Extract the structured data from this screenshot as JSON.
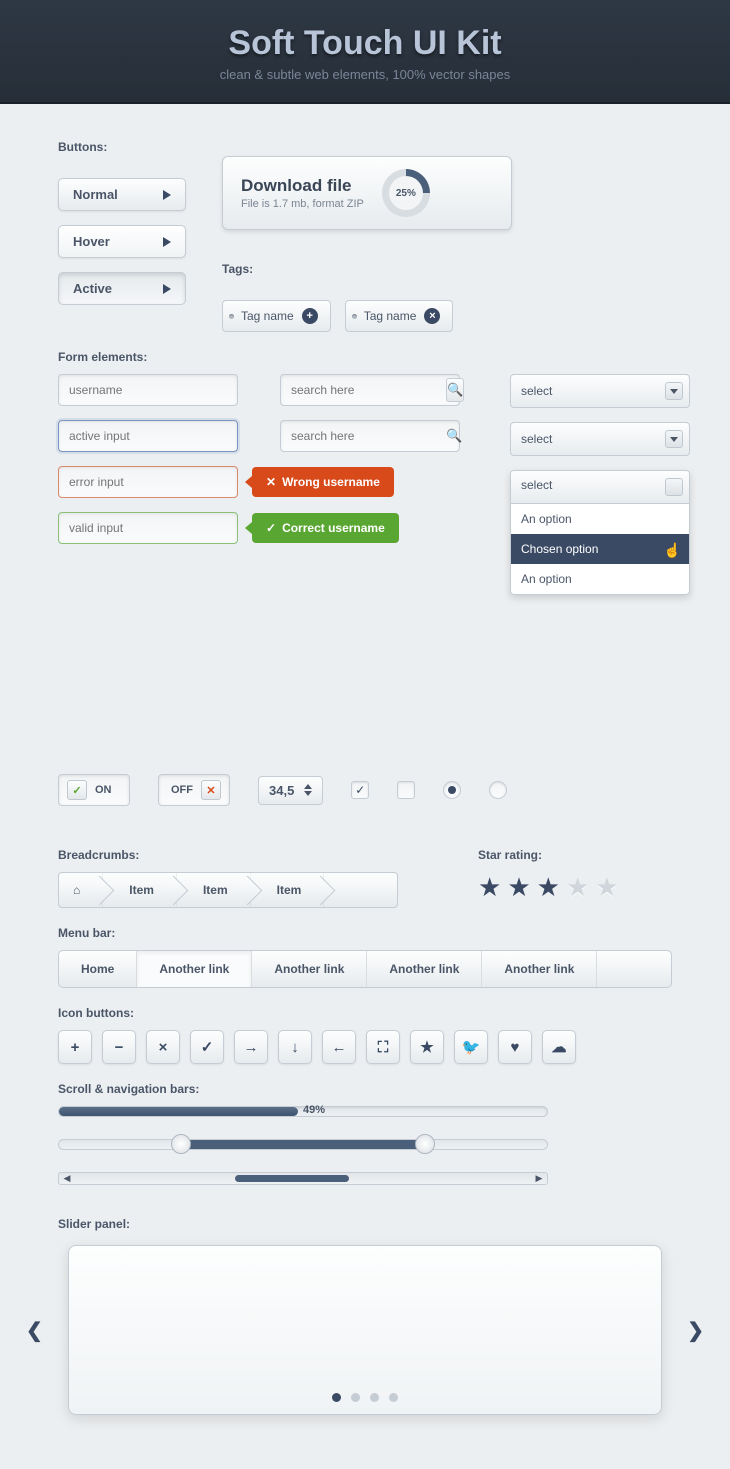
{
  "header": {
    "title": "Soft Touch UI Kit",
    "subtitle": "clean & subtle web elements, 100% vector shapes"
  },
  "sections": {
    "buttons": "Buttons:",
    "tags": "Tags:",
    "forms": "Form elements:",
    "crumbs": "Breadcrumbs:",
    "stars": "Star rating:",
    "menu": "Menu bar:",
    "icons": "Icon buttons:",
    "scroll": "Scroll & navigation bars:",
    "slider": "Slider panel:"
  },
  "buttons": {
    "normal": "Normal",
    "hover": "Hover",
    "active": "Active"
  },
  "download": {
    "title": "Download file",
    "sub": "File is 1.7 mb, format ZIP",
    "pct": "25%"
  },
  "tags": [
    "Tag name",
    "Tag name"
  ],
  "inputs": {
    "ph0": "username",
    "ph1": "active input",
    "ph2": "error input",
    "ph3": "valid input",
    "search": "search here"
  },
  "tips": {
    "err": "Wrong username",
    "ok": "Correct username"
  },
  "select": {
    "label": "select",
    "opts": [
      "An option",
      "Chosen option",
      "An option"
    ]
  },
  "toggle": {
    "on": "ON",
    "off": "OFF"
  },
  "spinner": "34,5",
  "crumbs": [
    "Item",
    "Item",
    "Item"
  ],
  "menu": [
    "Home",
    "Another link",
    "Another link",
    "Another link",
    "Another link"
  ],
  "progress": {
    "pct": 49,
    "label": "49%"
  },
  "range": {
    "lo": 25,
    "hi": 75
  },
  "scrollbar": {
    "pos": 35,
    "len": 25
  }
}
